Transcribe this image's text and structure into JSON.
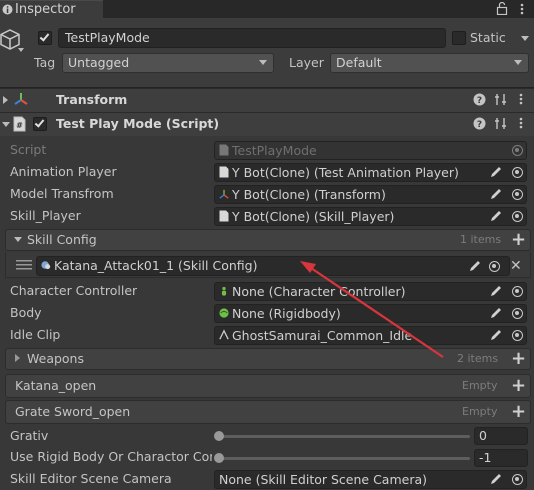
{
  "window": {
    "tab_title": "Inspector"
  },
  "gameobject": {
    "name": "TestPlayMode",
    "active": true,
    "static_label": "Static",
    "static_checked": false,
    "tag_label": "Tag",
    "tag_value": "Untagged",
    "layer_label": "Layer",
    "layer_value": "Default"
  },
  "components": {
    "transform": {
      "title": "Transform"
    },
    "script": {
      "title": "Test Play Mode (Script)",
      "enabled": true
    }
  },
  "fields": {
    "script": {
      "label": "Script",
      "value": "TestPlayMode"
    },
    "animation_player": {
      "label": "Animation Player",
      "value": "Y Bot(Clone) (Test Animation Player)"
    },
    "model_transform": {
      "label": "Model Transfrom",
      "value": "Y Bot(Clone) (Transform)"
    },
    "skill_player": {
      "label": "Skill_Player",
      "value": "Y Bot(Clone) (Skill_Player)"
    },
    "skill_config": {
      "label": "Skill Config",
      "count": "1 items",
      "item_value": "Katana_Attack01_1 (Skill Config)"
    },
    "character_controller": {
      "label": "Character Controller",
      "value": "None (Character Controller)"
    },
    "body": {
      "label": "Body",
      "value": "None (Rigidbody)"
    },
    "idle_clip": {
      "label": "Idle Clip",
      "value": "GhostSamurai_Common_Idle"
    },
    "weapons": {
      "label": "Weapons",
      "count": "2 items"
    },
    "katana_open": {
      "label": "Katana_open",
      "count": "Empty"
    },
    "grate_sword_open": {
      "label": "Grate Sword_open",
      "count": "Empty"
    },
    "gravity": {
      "label": "Grativ",
      "value": "0",
      "slider_fraction": 0
    },
    "use_rigidbody": {
      "label": "Use Rigid Body Or Charactor Cont",
      "value": "-1",
      "slider_fraction": 0
    },
    "scene_camera": {
      "label": "Skill Editor Scene Camera",
      "value": "None (Skill Editor Scene Camera)"
    }
  },
  "colors": {
    "annotation_arrow": "#d9353c",
    "unity_blue": "#3f7fd6"
  }
}
